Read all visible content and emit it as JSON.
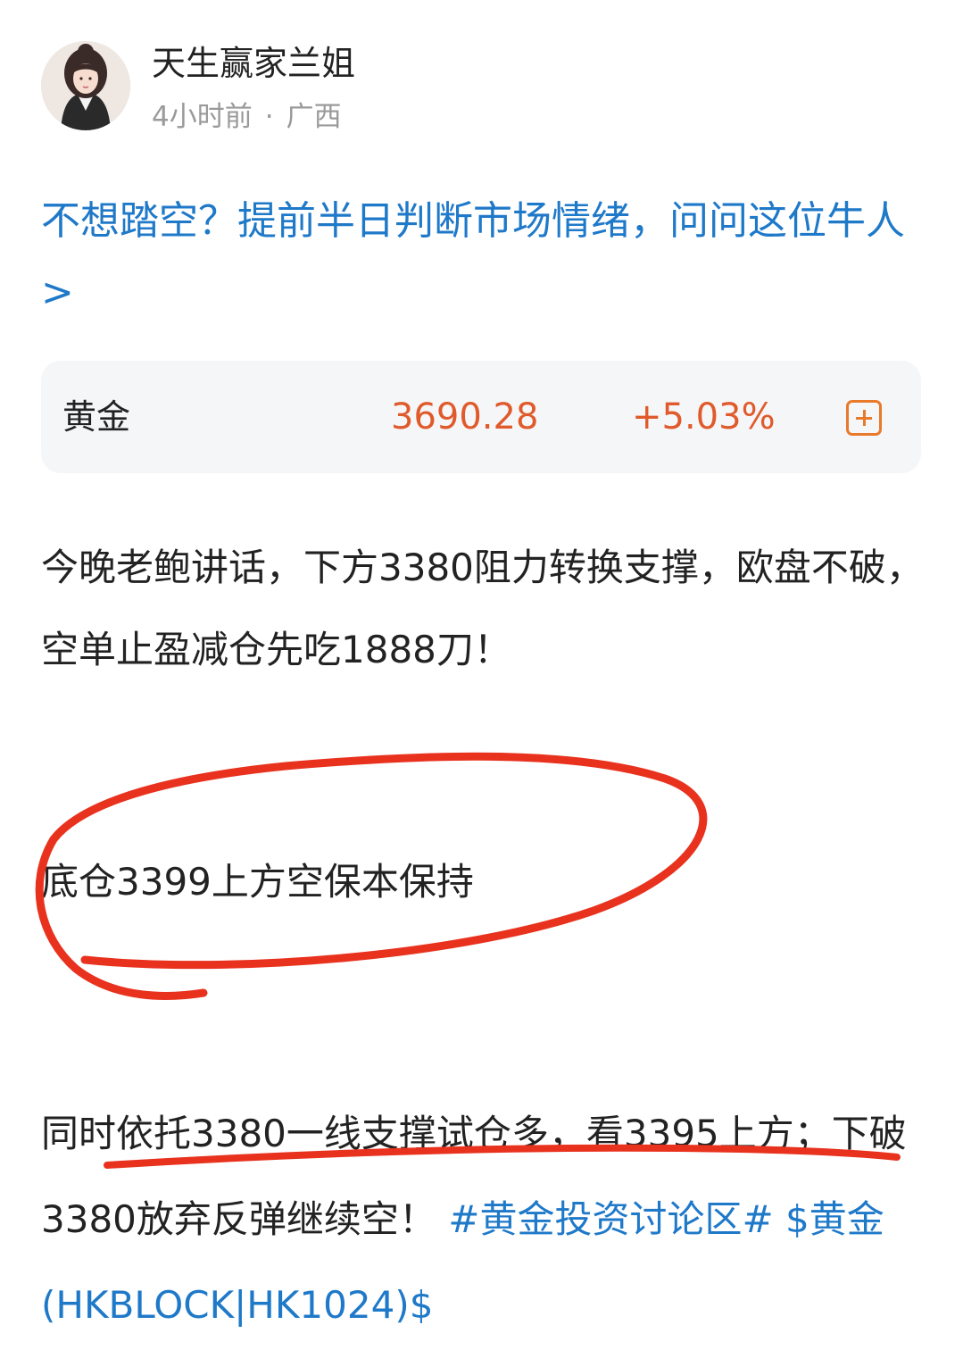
{
  "author": {
    "name": "天生赢家兰姐",
    "time": "4小时前",
    "separator": "·",
    "location": "广西"
  },
  "promo_link": "不想踏空？提前半日判断市场情绪，问问这位牛人>",
  "stock_card": {
    "name": "黄金",
    "price": "3690.28",
    "change": "+5.03%",
    "add_icon": "plus-square-icon",
    "accent_color": "#e05a2b"
  },
  "post": {
    "paragraph1": "今晚老鲍讲话，下方3380阻力转换支撑，欧盘不破，空单止盈减仓先吃1888刀！",
    "paragraph2": "底仓3399上方空保本保持",
    "paragraph3_text": "同时依托3380一线支撑试仓多，看3395上方；下破3380放弃反弹继续空！",
    "hashtag": "#黄金投资讨论区#",
    "stock_tag": "$黄金(HKBLOCK|HK1024)$"
  },
  "annotation_color": "#e8321e",
  "link_color": "#1f79c9"
}
